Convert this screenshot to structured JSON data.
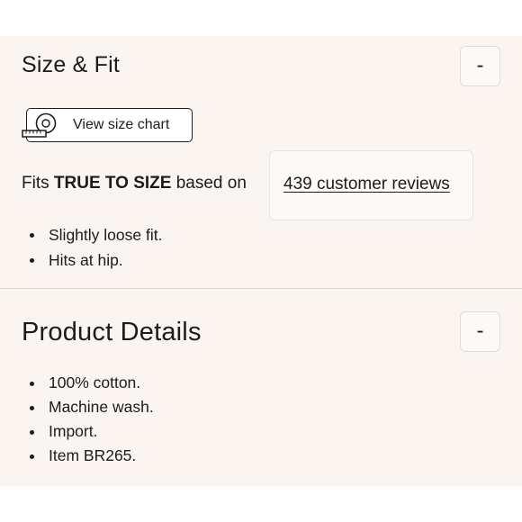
{
  "size_fit": {
    "title": "Size & Fit",
    "collapse_symbol": "-",
    "size_chart_label": "View size chart",
    "fit_prefix": "Fits",
    "fit_value": "TRUE TO SIZE",
    "fit_suffix": "based on",
    "reviews_link": "439 customer reviews",
    "notes": [
      "Slightly loose fit.",
      "Hits at hip."
    ]
  },
  "product_details": {
    "title": "Product Details",
    "collapse_symbol": "-",
    "items": [
      "100% cotton.",
      "Machine wash.",
      "Import.",
      "Item BR265."
    ]
  },
  "colors": {
    "panel_background": "#faf5f1",
    "text": "#1c1c1c",
    "divider": "#dcd6d1"
  },
  "icons": {
    "size_chart": "measuring-tape-icon"
  }
}
